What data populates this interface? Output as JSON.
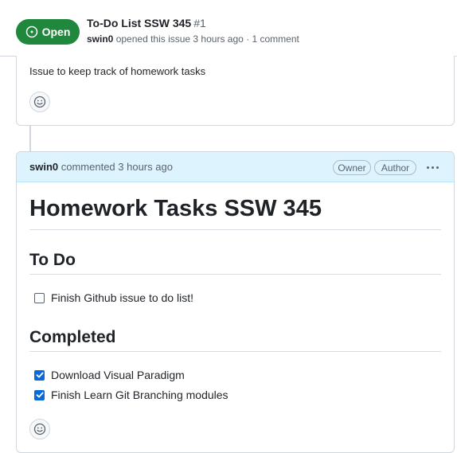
{
  "issue": {
    "state": "Open",
    "title": "To-Do List SSW 345",
    "number": "#1",
    "author": "swin0",
    "meta_text": " opened this issue 3 hours ago · 1 comment"
  },
  "first_comment": {
    "body": "Issue to keep track of homework tasks"
  },
  "comment": {
    "author": "swin0",
    "action_text": " commented 3 hours ago",
    "badges": [
      "Owner",
      "Author"
    ],
    "heading": "Homework Tasks SSW 345",
    "sections": [
      {
        "title": "To Do",
        "tasks": [
          {
            "label": "Finish Github issue to do list!",
            "checked": false
          }
        ]
      },
      {
        "title": "Completed",
        "tasks": [
          {
            "label": "Download Visual Paradigm",
            "checked": true
          },
          {
            "label": "Finish Learn Git Branching modules",
            "checked": true
          }
        ]
      }
    ]
  },
  "colors": {
    "open_green": "#1f883d",
    "header_blue": "#ddf4ff",
    "checkbox_blue": "#0969da"
  },
  "icons": {
    "state": "issue-opened-icon",
    "reaction": "smiley-icon",
    "menu": "kebab-horizontal-icon"
  }
}
